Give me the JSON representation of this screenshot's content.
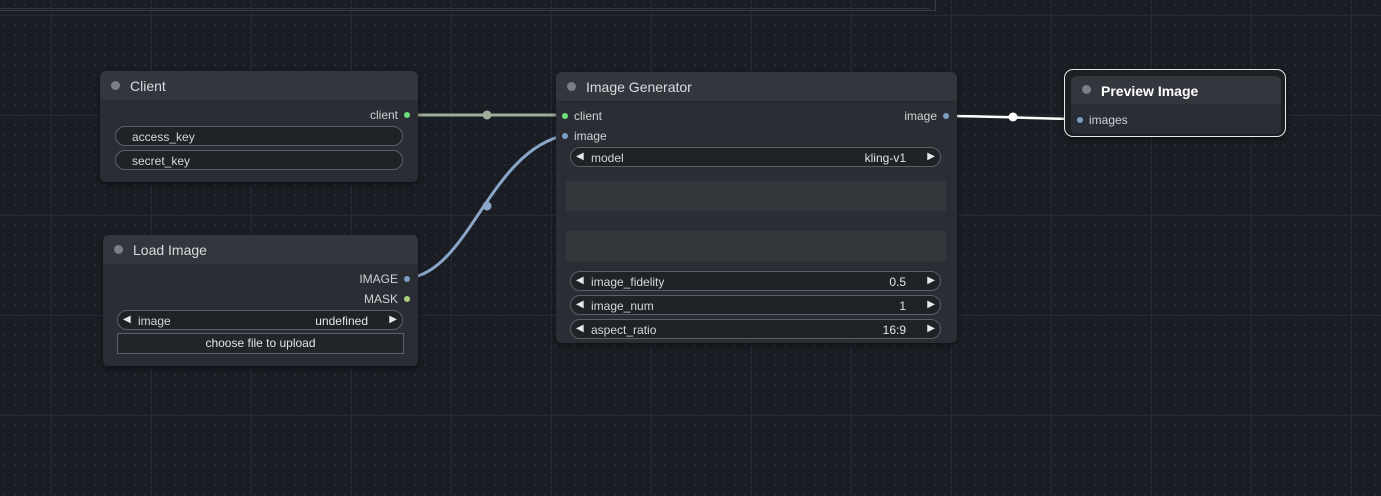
{
  "nodes": {
    "client": {
      "title": "Client",
      "output": "client",
      "widgets": [
        "access_key",
        "secret_key"
      ]
    },
    "load_image": {
      "title": "Load Image",
      "outputs": [
        "IMAGE",
        "MASK"
      ],
      "image_combo": {
        "label": "image",
        "value": "undefined"
      },
      "upload_button": "choose file to upload"
    },
    "image_generator": {
      "title": "Image Generator",
      "inputs": [
        "client",
        "image"
      ],
      "output": "image",
      "model": {
        "label": "model",
        "value": "kling-v1"
      },
      "image_fidelity": {
        "label": "image_fidelity",
        "value": "0.5"
      },
      "image_num": {
        "label": "image_num",
        "value": "1"
      },
      "aspect_ratio": {
        "label": "aspect_ratio",
        "value": "16:9"
      }
    },
    "preview_image": {
      "title": "Preview Image",
      "input": "images"
    }
  },
  "colors": {
    "client_link": "#9fae9c",
    "image_link": "#8aa6c8",
    "preview_link": "#ffffff",
    "client_slot": "#6ee07a",
    "image_slot": "#7e9fc4",
    "mask_slot": "#a7d17d"
  }
}
